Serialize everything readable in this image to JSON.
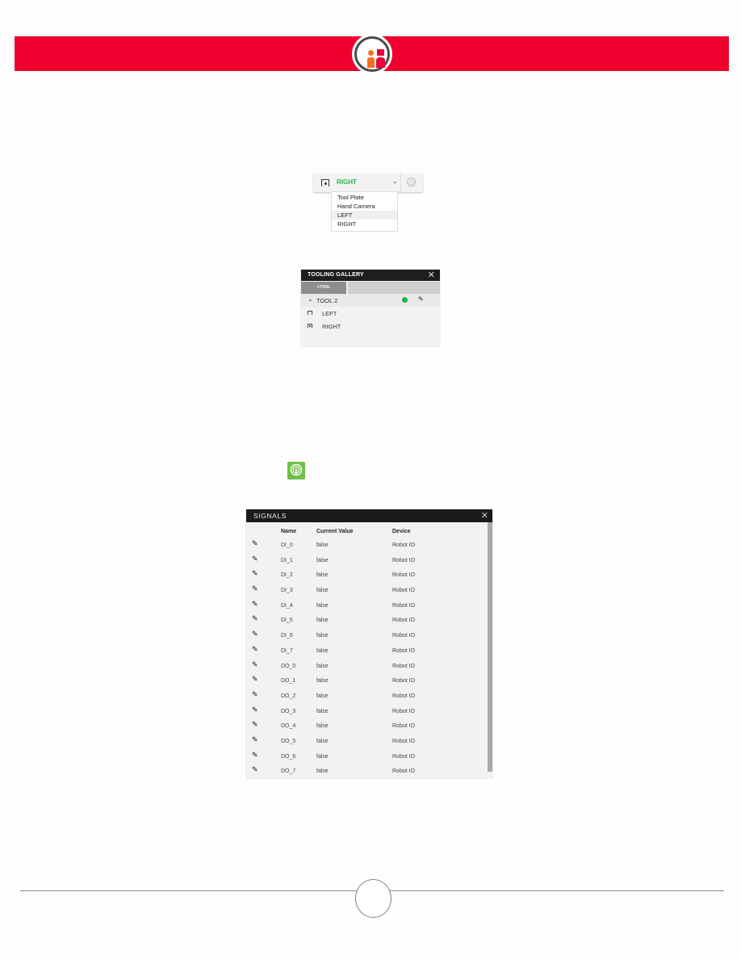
{
  "header": {
    "brand_colors": {
      "band": "#f0002e",
      "logo_orange": "#f37021",
      "logo_red": "#e8003a"
    },
    "logo_icon": "rethink-robotics-logo-icon"
  },
  "frame_selector": {
    "selected_value": "RIGHT",
    "selected_color": "#2bb34a",
    "frame_icon": "camera-frame-icon",
    "caret_icon": "chevron-down-icon",
    "caret_glyph": "⌄",
    "target_icon": "target-icon",
    "options": [
      {
        "label": "Tool Plate"
      },
      {
        "label": "Hand Camera"
      },
      {
        "label": "LEFT",
        "highlighted": true
      },
      {
        "label": "RIGHT"
      }
    ]
  },
  "tooling_gallery": {
    "title": "TOOLING GALLERY",
    "close_glyph": "✕",
    "add_tool_label": "+TOOL",
    "tool": {
      "name": "TOOL 2",
      "chevron_glyph": "⌄",
      "status_color": "#1db34c",
      "edit_glyph": "✎"
    },
    "frames": [
      {
        "label": "LEFT",
        "icon": "frame-icon"
      },
      {
        "label": "RIGHT",
        "icon": "frame-filled-icon"
      }
    ]
  },
  "signals_app_icon": {
    "name": "signals-icon",
    "color": "#6fc04b"
  },
  "signals": {
    "title": "SIGNALS",
    "close_glyph": "✕",
    "columns": [
      "Name",
      "Current Value",
      "Device"
    ],
    "edit_glyph": "✎",
    "rows": [
      {
        "name": "DI_0",
        "value": "false",
        "device": "Robot IO"
      },
      {
        "name": "DI_1",
        "value": "false",
        "device": "Robot IO"
      },
      {
        "name": "DI_2",
        "value": "false",
        "device": "Robot IO"
      },
      {
        "name": "DI_3",
        "value": "false",
        "device": "Robot IO"
      },
      {
        "name": "DI_4",
        "value": "false",
        "device": "Robot IO"
      },
      {
        "name": "DI_5",
        "value": "false",
        "device": "Robot IO"
      },
      {
        "name": "DI_6",
        "value": "false",
        "device": "Robot IO"
      },
      {
        "name": "DI_7",
        "value": "false",
        "device": "Robot IO"
      },
      {
        "name": "DO_0",
        "value": "false",
        "device": "Robot IO"
      },
      {
        "name": "DO_1",
        "value": "false",
        "device": "Robot IO"
      },
      {
        "name": "DO_2",
        "value": "false",
        "device": "Robot IO"
      },
      {
        "name": "DO_3",
        "value": "false",
        "device": "Robot IO"
      },
      {
        "name": "DO_4",
        "value": "false",
        "device": "Robot IO"
      },
      {
        "name": "DO_5",
        "value": "false",
        "device": "Robot IO"
      },
      {
        "name": "DO_6",
        "value": "false",
        "device": "Robot IO"
      },
      {
        "name": "DO_7",
        "value": "false",
        "device": "Robot IO"
      }
    ]
  }
}
